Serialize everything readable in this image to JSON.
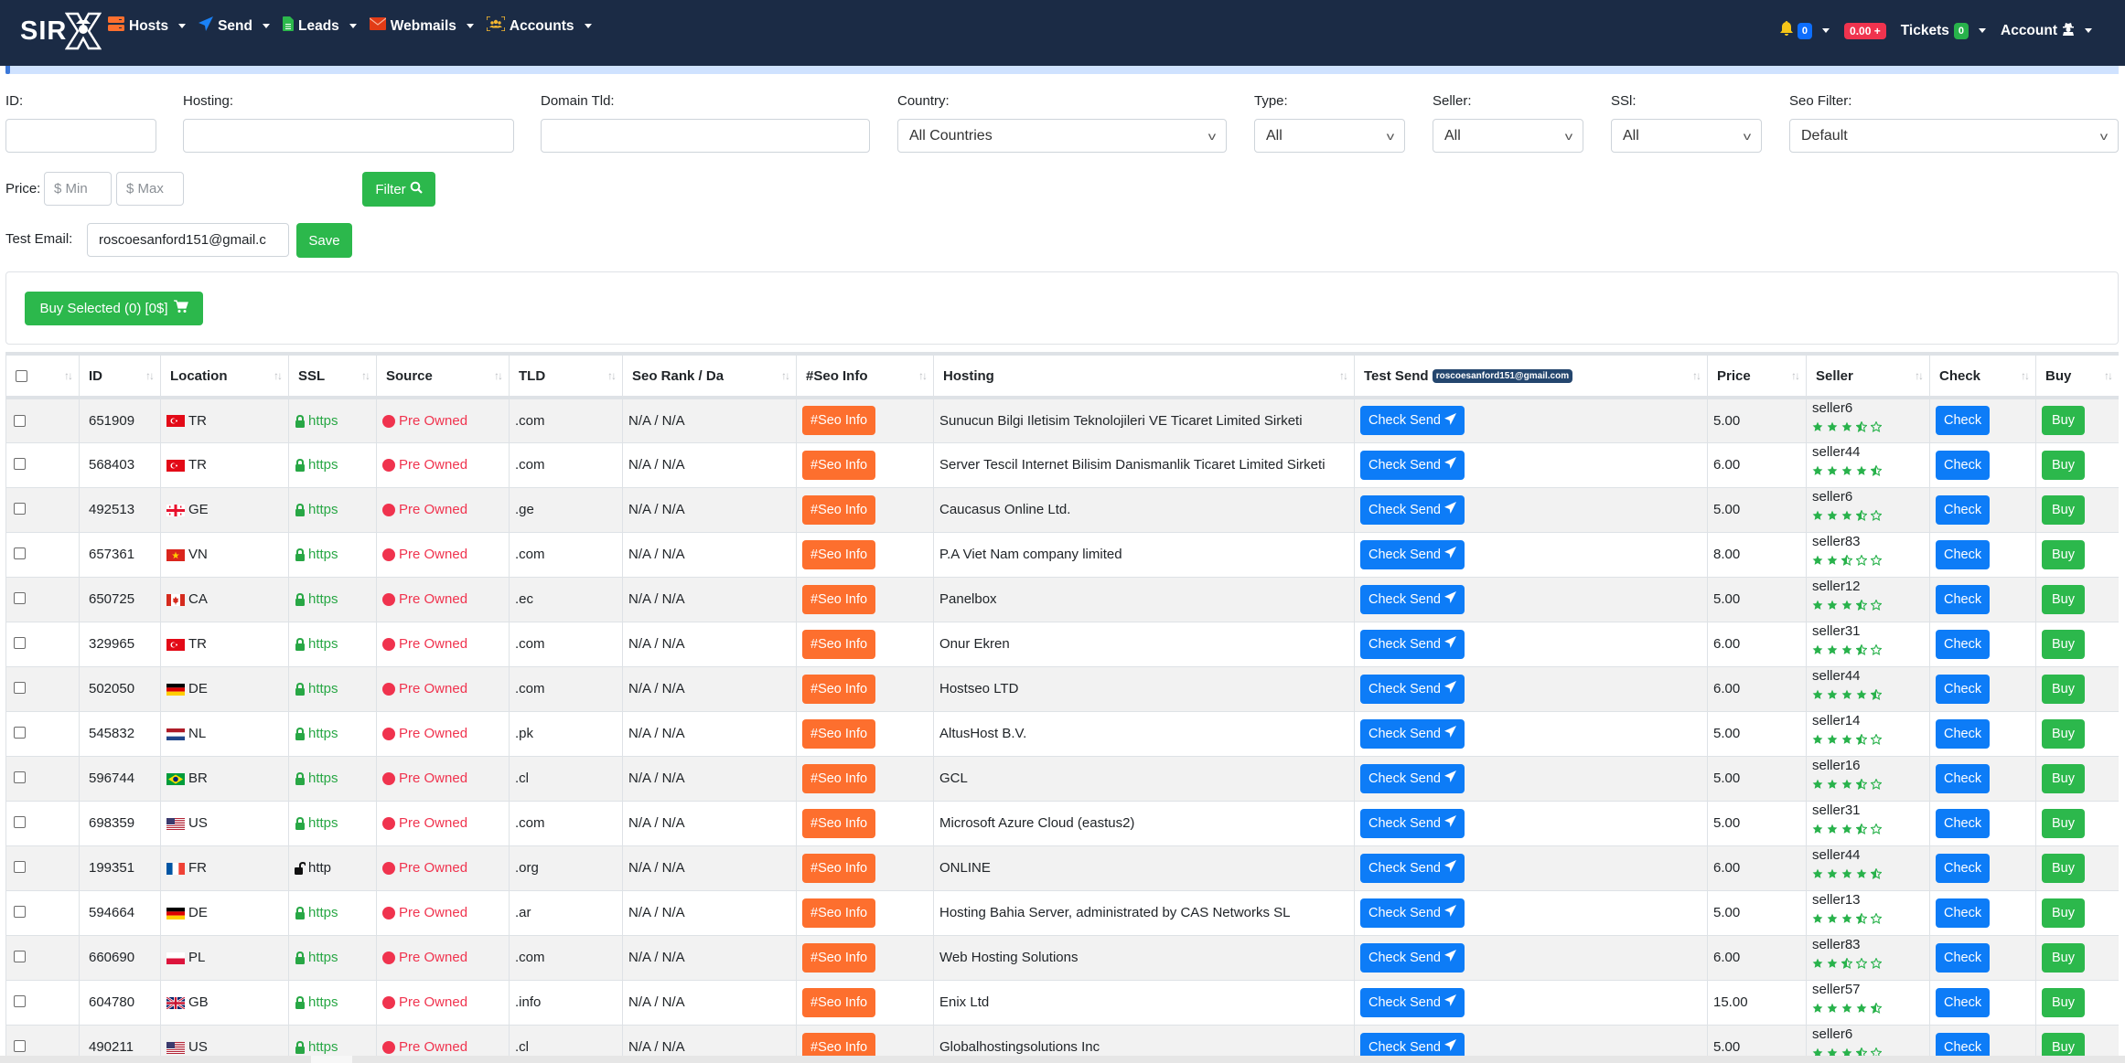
{
  "brand": {
    "logo_text": "SIR",
    "logo_mark": "X"
  },
  "nav": {
    "left": [
      {
        "label": "Hosts",
        "icon": "server-icon",
        "color": "#fd6f2e"
      },
      {
        "label": "Send",
        "icon": "paper-plane-icon",
        "color": "#1a82f7"
      },
      {
        "label": "Leads",
        "icon": "file-icon",
        "color": "#2cb84c"
      },
      {
        "label": "Webmails",
        "icon": "envelope-icon",
        "color": "#e23b16"
      },
      {
        "label": "Accounts",
        "icon": "users-icon",
        "color": "#f5b731"
      }
    ],
    "notifications_count": "0",
    "balance": "0.00",
    "tickets_label": "Tickets",
    "tickets_count": "0",
    "account_label": "Account"
  },
  "progress": {
    "value_percent": 0.2
  },
  "filters": {
    "id_label": "ID:",
    "id_value": "",
    "hosting_label": "Hosting:",
    "hosting_value": "",
    "domain_tld_label": "Domain Tld:",
    "domain_tld_value": "",
    "country_label": "Country:",
    "country_value": "All Countries",
    "type_label": "Type:",
    "type_value": "All",
    "seller_label": "Seller:",
    "seller_value": "All",
    "ssl_label": "SSl:",
    "ssl_value": "All",
    "seo_filter_label": "Seo Filter:",
    "seo_filter_value": "Default",
    "price_label": "Price:",
    "price_min_placeholder": "$ Min",
    "price_max_placeholder": "$ Max",
    "filter_button": "Filter",
    "test_email_label": "Test Email:",
    "test_email_value": "roscoesanford151@gmail.c",
    "save_button": "Save"
  },
  "buy_selected": {
    "label": "Buy Selected (0) [0$]"
  },
  "table": {
    "columns": [
      "",
      "ID",
      "Location",
      "SSL",
      "Source",
      "TLD",
      "Seo Rank / Da",
      "#Seo Info",
      "Hosting",
      "Test Send",
      "Price",
      "Seller",
      "Check",
      "Buy"
    ],
    "test_send_badge": "roscoesanford151@gmail.com",
    "seo_info_label": "#Seo Info",
    "check_send_label": "Check Send",
    "check_label": "Check",
    "buy_label": "Buy",
    "rows": [
      {
        "id": "651909",
        "country": "TR",
        "ssl": "https",
        "source": "Pre Owned",
        "tld": ".com",
        "seo": "N/A / N/A",
        "hosting": "Sunucun Bilgi Iletisim Teknolojileri VE Ticaret Limited Sirketi",
        "price": "5.00",
        "seller": "seller6",
        "rating": 3.5
      },
      {
        "id": "568403",
        "country": "TR",
        "ssl": "https",
        "source": "Pre Owned",
        "tld": ".com",
        "seo": "N/A / N/A",
        "hosting": "Server Tescil Internet Bilisim Danismanlik Ticaret Limited Sirketi",
        "price": "6.00",
        "seller": "seller44",
        "rating": 4.5
      },
      {
        "id": "492513",
        "country": "GE",
        "ssl": "https",
        "source": "Pre Owned",
        "tld": ".ge",
        "seo": "N/A / N/A",
        "hosting": "Caucasus Online Ltd.",
        "price": "5.00",
        "seller": "seller6",
        "rating": 3.5
      },
      {
        "id": "657361",
        "country": "VN",
        "ssl": "https",
        "source": "Pre Owned",
        "tld": ".com",
        "seo": "N/A / N/A",
        "hosting": "P.A Viet Nam company limited",
        "price": "8.00",
        "seller": "seller83",
        "rating": 2.5
      },
      {
        "id": "650725",
        "country": "CA",
        "ssl": "https",
        "source": "Pre Owned",
        "tld": ".ec",
        "seo": "N/A / N/A",
        "hosting": "Panelbox",
        "price": "5.00",
        "seller": "seller12",
        "rating": 3.5
      },
      {
        "id": "329965",
        "country": "TR",
        "ssl": "https",
        "source": "Pre Owned",
        "tld": ".com",
        "seo": "N/A / N/A",
        "hosting": "Onur Ekren",
        "price": "6.00",
        "seller": "seller31",
        "rating": 3.5
      },
      {
        "id": "502050",
        "country": "DE",
        "ssl": "https",
        "source": "Pre Owned",
        "tld": ".com",
        "seo": "N/A / N/A",
        "hosting": "Hostseo LTD",
        "price": "6.00",
        "seller": "seller44",
        "rating": 4.5
      },
      {
        "id": "545832",
        "country": "NL",
        "ssl": "https",
        "source": "Pre Owned",
        "tld": ".pk",
        "seo": "N/A / N/A",
        "hosting": "AltusHost B.V.",
        "price": "5.00",
        "seller": "seller14",
        "rating": 3.5
      },
      {
        "id": "596744",
        "country": "BR",
        "ssl": "https",
        "source": "Pre Owned",
        "tld": ".cl",
        "seo": "N/A / N/A",
        "hosting": "GCL",
        "price": "5.00",
        "seller": "seller16",
        "rating": 3.5
      },
      {
        "id": "698359",
        "country": "US",
        "ssl": "https",
        "source": "Pre Owned",
        "tld": ".com",
        "seo": "N/A / N/A",
        "hosting": "Microsoft Azure Cloud (eastus2)",
        "price": "5.00",
        "seller": "seller31",
        "rating": 3.5
      },
      {
        "id": "199351",
        "country": "FR",
        "ssl": "http",
        "source": "Pre Owned",
        "tld": ".org",
        "seo": "N/A / N/A",
        "hosting": "ONLINE",
        "price": "6.00",
        "seller": "seller44",
        "rating": 4.5
      },
      {
        "id": "594664",
        "country": "DE",
        "ssl": "https",
        "source": "Pre Owned",
        "tld": ".ar",
        "seo": "N/A / N/A",
        "hosting": "Hosting Bahia Server, administrated by CAS Networks SL",
        "price": "5.00",
        "seller": "seller13",
        "rating": 3.5
      },
      {
        "id": "660690",
        "country": "PL",
        "ssl": "https",
        "source": "Pre Owned",
        "tld": ".com",
        "seo": "N/A / N/A",
        "hosting": "Web Hosting Solutions",
        "price": "6.00",
        "seller": "seller83",
        "rating": 2.5
      },
      {
        "id": "604780",
        "country": "GB",
        "ssl": "https",
        "source": "Pre Owned",
        "tld": ".info",
        "seo": "N/A / N/A",
        "hosting": "Enix Ltd",
        "price": "15.00",
        "seller": "seller57",
        "rating": 4.5
      },
      {
        "id": "490211",
        "country": "US",
        "ssl": "https",
        "source": "Pre Owned",
        "tld": ".cl",
        "seo": "N/A / N/A",
        "hosting": "Globalhostingsolutions Inc",
        "price": "5.00",
        "seller": "seller6",
        "rating": 3.5
      }
    ]
  }
}
